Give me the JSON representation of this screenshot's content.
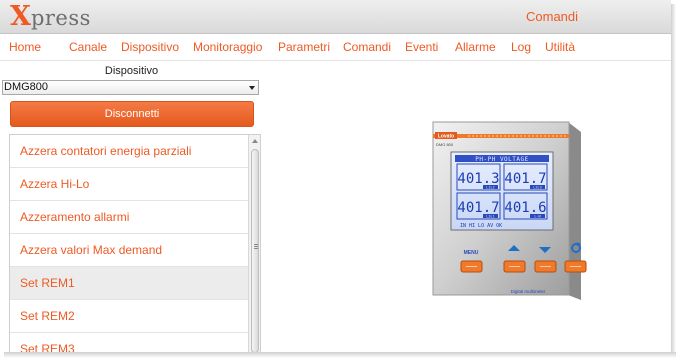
{
  "app": {
    "logo_first_letter": "X",
    "logo_rest": "press",
    "page_label": "Comandi"
  },
  "nav": {
    "items": [
      {
        "label": "Home"
      },
      {
        "label": "Canale"
      },
      {
        "label": "Dispositivo"
      },
      {
        "label": "Monitoraggio"
      },
      {
        "label": "Parametri"
      },
      {
        "label": "Comandi"
      },
      {
        "label": "Eventi"
      },
      {
        "label": "Allarme"
      },
      {
        "label": "Log"
      },
      {
        "label": "Utilità"
      }
    ]
  },
  "device_panel": {
    "label": "Dispositivo",
    "selected_device": "DMG800",
    "disconnect_label": "Disconnetti"
  },
  "commands": {
    "items": [
      {
        "label": "Azzera contatori energia parziali"
      },
      {
        "label": "Azzera Hi-Lo"
      },
      {
        "label": "Azzeramento allarmi"
      },
      {
        "label": "Azzera valori Max demand"
      },
      {
        "label": "Set REM1"
      },
      {
        "label": "Set REM2"
      },
      {
        "label": "Set REM3"
      }
    ],
    "selected_index": 4
  },
  "meter": {
    "brand": "Lovato",
    "model": "DMG 800",
    "header": "PH-PH VOLTAGE",
    "readings": [
      {
        "value": "401.3",
        "phase": "L1L2"
      },
      {
        "value": "401.7",
        "phase": "L2L3"
      },
      {
        "value": "401.7",
        "phase": "L3L1"
      },
      {
        "value": "401.6",
        "phase": "L-N"
      }
    ],
    "footer": "IN HI LO AV OK",
    "menu_label": "MENU",
    "caption": "Digital multimeter"
  },
  "colors": {
    "accent": "#ef5a24",
    "button": "#e95d22",
    "lcd_bg": "#dfe8ff",
    "lcd_text": "#1c3db0"
  },
  "icons": [
    "chevron-down-icon",
    "scroll-up-arrow-icon",
    "arrow-up-icon",
    "arrow-down-icon",
    "refresh-icon"
  ]
}
